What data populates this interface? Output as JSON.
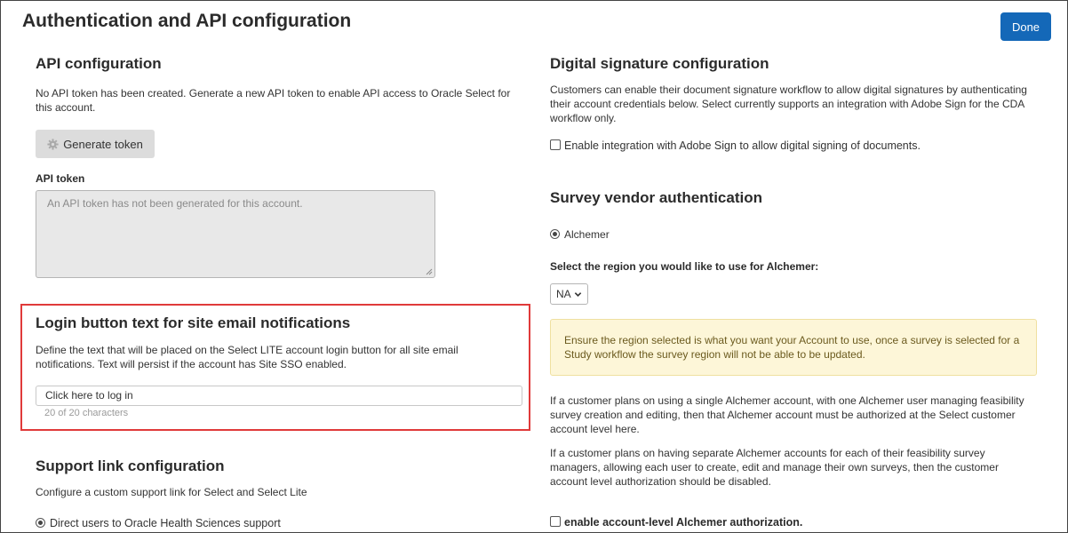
{
  "header": {
    "title": "Authentication and API configuration",
    "done_label": "Done"
  },
  "api": {
    "title": "API configuration",
    "description": "No API token has been created. Generate a new API token to enable API access to Oracle Select for this account.",
    "generate_label": "Generate token",
    "token_label": "API token",
    "token_placeholder": "An API token has not been generated for this account."
  },
  "login": {
    "title": "Login button text for site email notifications",
    "description": "Define the text that will be placed on the Select LITE account login button for all site email notifications. Text will persist if the account has Site SSO enabled.",
    "value": "Click here to log in",
    "counter": "20 of 20 characters"
  },
  "support": {
    "title": "Support link configuration",
    "description": "Configure a custom support link for Select and Select Lite",
    "option_label": "Direct users to Oracle Health Sciences support"
  },
  "digital_signature": {
    "title": "Digital signature configuration",
    "description": "Customers can enable their document signature workflow to allow digital signatures by authenticating their account credentials below. Select currently supports an integration with Adobe Sign for the CDA workflow only.",
    "checkbox_label": "Enable integration with Adobe Sign to allow digital signing of documents."
  },
  "survey": {
    "title": "Survey vendor authentication",
    "vendor_label": "Alchemer",
    "region_label": "Select the region you would like to use for Alchemer:",
    "region_value": "NA",
    "warning": "Ensure the region selected is what you want your Account to use, once a survey is selected for a Study workflow the survey region will not be able to be updated.",
    "info1": "If a customer plans on using a single Alchemer account, with one Alchemer user managing feasibility survey creation and editing, then that Alchemer account must be authorized at the Select customer account level here.",
    "info2": "If a customer plans on having separate Alchemer accounts for each of their feasibility survey managers, allowing each user to create, edit and manage their own surveys, then the customer account level authorization should be disabled.",
    "auth_checkbox_label": "enable account-level Alchemer authorization."
  },
  "colors": {
    "primary": "#1468b8",
    "highlight_border": "#e03a3a",
    "warning_bg": "#fdf6d8"
  }
}
